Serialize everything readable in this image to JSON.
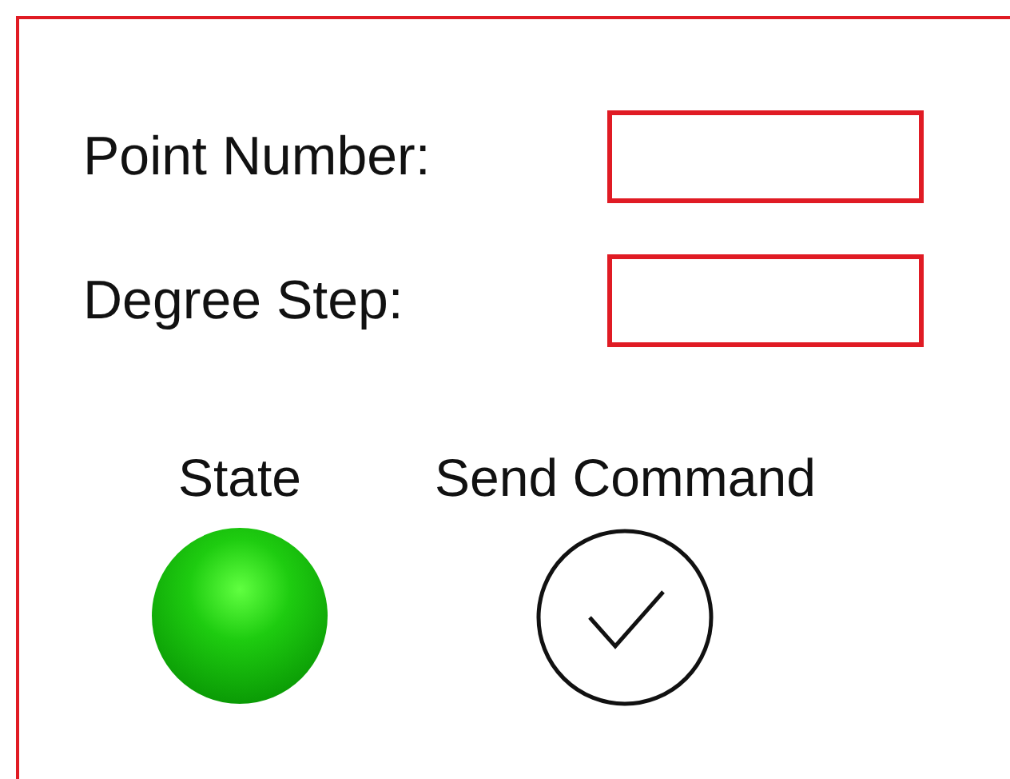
{
  "fields": [
    {
      "label": "Point Number:"
    },
    {
      "label": "Degree Step:"
    }
  ],
  "state": {
    "label": "State",
    "on": true
  },
  "send": {
    "label": "Send Command"
  }
}
